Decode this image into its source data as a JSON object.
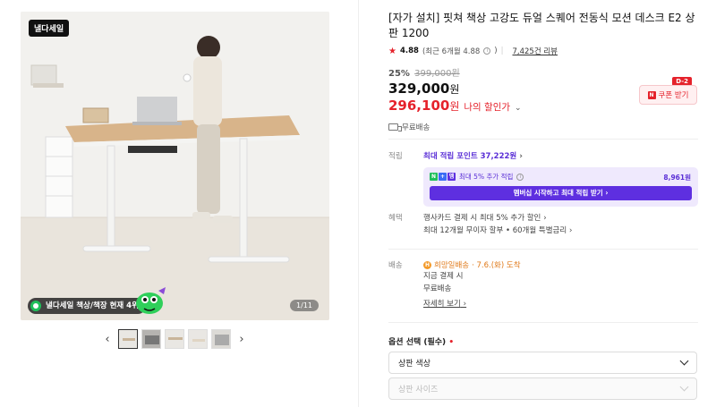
{
  "gallery": {
    "sale_logo": "낼다세일",
    "rank_text": "낼다세일 책상/책장 현재 4위",
    "page_counter": "1/11",
    "prev_label": "‹",
    "next_label": "›"
  },
  "product": {
    "title": "[자가 설치] 핏쳐 책상 고강도 듀얼 스퀘어 전동식 모션 데스크 E2 상판 1200",
    "rating": "4.88",
    "recent_rating": "(최근 6개월 4.88",
    "recent_rating_tail": ")",
    "reviews": "7,425건 리뷰",
    "discount_rate": "25%",
    "original_price": "399,000원",
    "price_number": "329,000",
    "price_unit": "원",
    "my_price_number": "296,100",
    "my_price_unit": "원",
    "my_price_label": "나의 할인가",
    "shipping": "무료배송"
  },
  "coupon": {
    "dday": "D-2",
    "label": "쿠폰 받기"
  },
  "points": {
    "label": "적립",
    "max_points": "최대 적립 포인트 37,222원",
    "extra_label": "최대 5% 추가 적립",
    "extra_amount": "8,961원",
    "membership_button": "멤버십 시작하고 최대 적립 받기"
  },
  "benefits": {
    "label": "혜택",
    "line1": "행사카드 결제 시 최대 5% 추가 할인",
    "line2": "최대 12개월 무이자 할부 • 60개월 특별금리"
  },
  "delivery": {
    "label": "배송",
    "hope_label": "희망일배송",
    "hope_date": "· 7.6.(화) 도착",
    "line1": "지금 결제 시",
    "line2": "무료배송",
    "detail_link": "자세히 보기"
  },
  "options": {
    "title": "옵션 선택 (필수)",
    "required_mark": "•",
    "select1": "상판 색상",
    "select2": "상판 사이즈"
  },
  "colors": {
    "accent_red": "#e5222b",
    "membership_purple": "#5e2fe0",
    "naver_green": "#1fbf5a"
  }
}
